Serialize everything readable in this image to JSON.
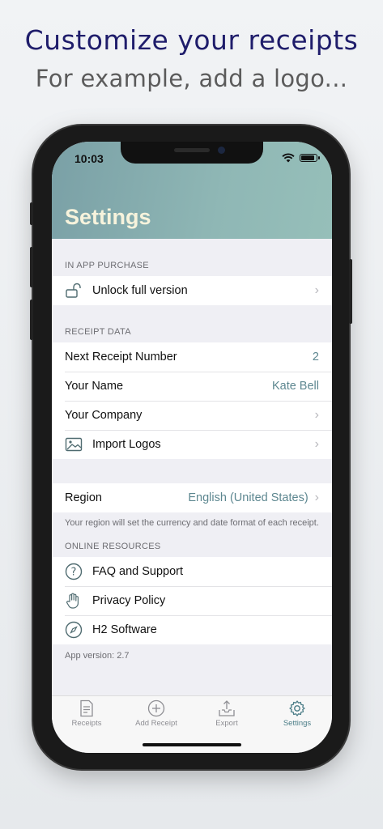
{
  "hero": {
    "title": "Customize your receipts",
    "subtitle": "For example, add a logo..."
  },
  "status_bar": {
    "time": "10:03"
  },
  "header": {
    "title": "Settings"
  },
  "sections": {
    "in_app": {
      "header": "IN APP PURCHASE",
      "unlock_label": "Unlock full version"
    },
    "receipt": {
      "header": "RECEIPT DATA",
      "next_number_label": "Next Receipt Number",
      "next_number_value": "2",
      "name_label": "Your Name",
      "name_value": "Kate Bell",
      "company_label": "Your Company",
      "logos_label": "Import Logos"
    },
    "region": {
      "label": "Region",
      "value": "English (United States)",
      "footnote": "Your region will set the currency and date format of each receipt."
    },
    "online": {
      "header": "ONLINE RESOURCES",
      "faq_label": "FAQ and Support",
      "privacy_label": "Privacy Policy",
      "h2_label": "H2 Software"
    },
    "app_version": "App version: 2.7"
  },
  "tabbar": {
    "receipts": "Receipts",
    "add_receipt": "Add Receipt",
    "export": "Export",
    "settings": "Settings"
  },
  "colors": {
    "accent": "#4b7d87",
    "hero_title": "#1f1d6b",
    "header_title": "#f7f3dc"
  }
}
